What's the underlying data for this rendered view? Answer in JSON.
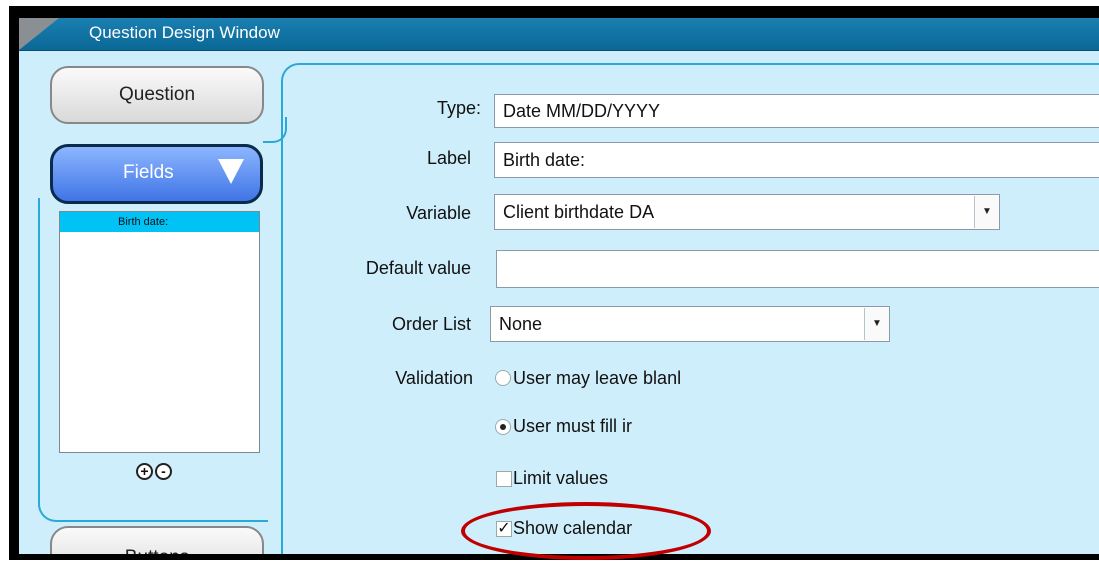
{
  "window": {
    "title": "Question Design Window"
  },
  "tabs": {
    "question": "Question",
    "fields": "Fields",
    "buttons": "Buttons"
  },
  "field_list": {
    "items": [
      "Birth date:"
    ]
  },
  "form": {
    "type_label": "Type:",
    "type_value": "Date MM/DD/YYYY",
    "label_label": "Label",
    "label_value": "Birth date:",
    "variable_label": "Variable",
    "variable_value": "Client birthdate DA",
    "default_label": "Default value",
    "default_value": "",
    "order_label": "Order List",
    "order_value": "None",
    "validation_label": "Validation",
    "opt_leave_blank": "User may leave blanl",
    "opt_must_fill": "User must fill ir",
    "limit_values": "Limit values",
    "show_calendar": "Show calendar"
  },
  "state": {
    "validation_selected": "User must fill ir",
    "limit_values_checked": false,
    "show_calendar_checked": true
  },
  "icons": {
    "add": "plus-circle-icon",
    "remove": "minus-circle-icon",
    "dropdown": "chevron-down-icon"
  }
}
